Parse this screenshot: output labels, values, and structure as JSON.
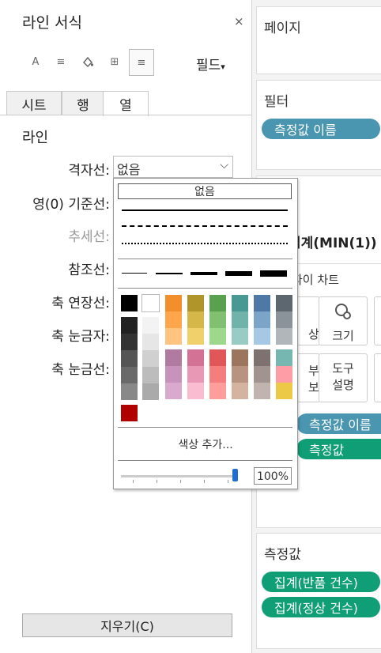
{
  "format_panel": {
    "title": "라인 서식",
    "close": "×",
    "toolbar_font": "A",
    "toolbar_align": "≡",
    "toolbar_grid": "⊞",
    "toolbar_lines": "≡",
    "field_dropdown": "필드",
    "tabs": [
      "시트",
      "행",
      "열"
    ],
    "active_tab": "열",
    "section": "라인",
    "rows": [
      {
        "label": "격자선:"
      },
      {
        "label": "영(0) 기준선:"
      },
      {
        "label": "추세선:"
      },
      {
        "label": "참조선:"
      },
      {
        "label": "축 연장선:"
      },
      {
        "label": "축 눈금자:"
      },
      {
        "label": "축 눈금선:"
      }
    ],
    "grid_value": "없음",
    "clear_button": "지우기(C)"
  },
  "line_popup": {
    "none_label": "없음",
    "add_color_label": "색상 추가...",
    "opacity_value": 0.97,
    "opacity_label": "100%",
    "colors": {
      "basic": [
        "#000000",
        "#ffffff"
      ],
      "grays": [
        [
          "#222222",
          "#f3f3f3"
        ],
        [
          "#333333",
          "#e6e6e6"
        ],
        [
          "#555555",
          "#d0d0d0"
        ],
        [
          "#6a6a6a",
          "#bcbcbc"
        ],
        [
          "#888888",
          "#aaaaaa"
        ]
      ],
      "palette": [
        [
          "#f28e2b",
          "#b0952b",
          "#59a14f",
          "#499894",
          "#4e79a7",
          "#5d6770"
        ],
        [
          "#ffa64d",
          "#d4b649",
          "#80c070",
          "#6fb3ab",
          "#7ba4c9",
          "#8a9399"
        ],
        [
          "#ffc480",
          "#f0d06a",
          "#9ed88a",
          "#97cbc3",
          "#a5c8e5",
          "#b0b6ba"
        ],
        [
          "#b07aa1",
          "#d37295",
          "#e15759",
          "#9c755f",
          "#7e7270",
          "#76b7b2"
        ],
        [
          "#c593bb",
          "#e898b5",
          "#f47d7d",
          "#b89480",
          "#a19490",
          "#ff9da7"
        ],
        [
          "#d9a9ce",
          "#f9bcd0",
          "#ff9d9a",
          "#d4b3a0",
          "#c1b4ae",
          "#edc948"
        ]
      ],
      "custom": [
        "#b00000"
      ]
    }
  },
  "right_panels": {
    "pages_title": "페이지",
    "filters_title": "필터",
    "filter_pill": "측정값 이름",
    "agg_title": "집계(MIN(1))",
    "marks_type": "파이 차트",
    "marks_btn_size": "크기",
    "marks_btn_tooltip_1": "도구",
    "marks_btn_tooltip_2": "설명",
    "marks_pill_1": "측정값 이름",
    "marks_pill_2": "측정값",
    "measures_title": "측정값",
    "measure_pill_1": "집계(반품 건수)",
    "measure_pill_2": "집계(정상 건수)"
  }
}
